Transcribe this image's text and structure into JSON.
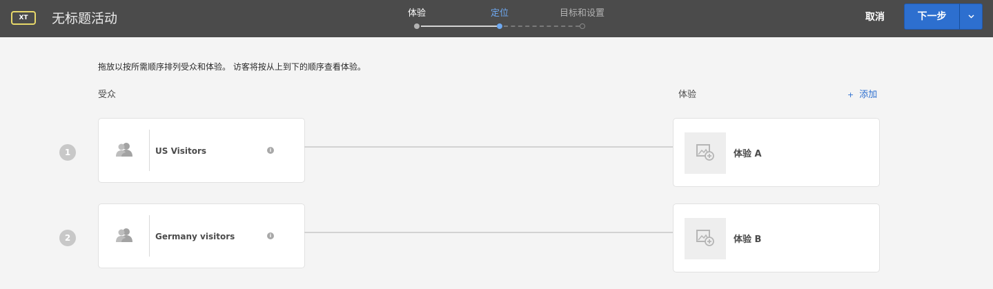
{
  "header": {
    "badge": "XT",
    "title": "无标题活动",
    "steps": [
      {
        "label": "体验",
        "state": "done"
      },
      {
        "label": "定位",
        "state": "active"
      },
      {
        "label": "目标和设置",
        "state": "pending"
      }
    ],
    "cancel_label": "取消",
    "next_label": "下一步",
    "next_dropdown_icon": "chevron-down-icon"
  },
  "main": {
    "instructions": "拖放以按所需顺序排列受众和体验。 访客将按从上到下的顺序查看体验。",
    "audience_header": "受众",
    "experience_header": "体验",
    "add_label": "添加",
    "add_icon": "+",
    "rows": [
      {
        "number": "1",
        "audience": "US Visitors",
        "experience": "体验 A"
      },
      {
        "number": "2",
        "audience": "Germany visitors",
        "experience": "体验 B"
      }
    ]
  },
  "colors": {
    "header_bg": "#4b4b4b",
    "accent": "#2d6fcf",
    "active_step": "#6ea9f2",
    "badge_border": "#e8d96a",
    "page_bg": "#f4f4f4"
  }
}
